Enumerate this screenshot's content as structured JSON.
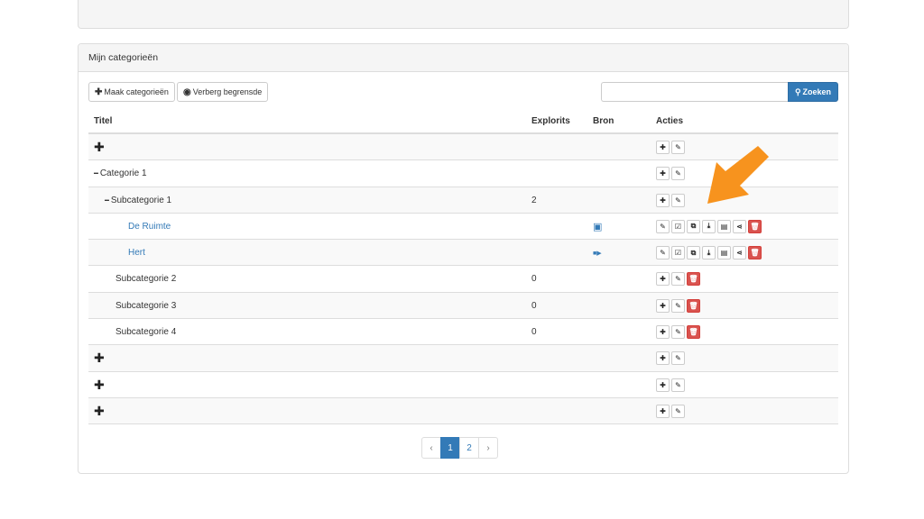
{
  "panel": {
    "heading": "Mijn categorieën"
  },
  "toolbar": {
    "create_label": "Maak categorieën",
    "hide_label": "Verberg begrensde",
    "search_placeholder": "",
    "search_label": "Zoeken"
  },
  "columns": {
    "title": "Titel",
    "explorits": "Explorits",
    "bron": "Bron",
    "acties": "Acties"
  },
  "rows": [
    {
      "title": "",
      "type": "add",
      "explorits": ""
    },
    {
      "title": "Categorie 1",
      "type": "category",
      "explorits": ""
    },
    {
      "title": "Subcategorie 1",
      "type": "subcategory",
      "explorits": "2"
    },
    {
      "title": "De Ruimte",
      "type": "item",
      "explorits": "",
      "bron": "image-icon"
    },
    {
      "title": "Hert",
      "type": "item",
      "explorits": "",
      "bron": "video-icon"
    },
    {
      "title": "Subcategorie 2",
      "type": "subcategory-plain",
      "explorits": "0"
    },
    {
      "title": "Subcategorie 3",
      "type": "subcategory-plain",
      "explorits": "0"
    },
    {
      "title": "Subcategorie 4",
      "type": "subcategory-plain",
      "explorits": "0"
    },
    {
      "title": "",
      "type": "add",
      "explorits": ""
    },
    {
      "title": "",
      "type": "add",
      "explorits": ""
    },
    {
      "title": "",
      "type": "add",
      "explorits": ""
    }
  ],
  "pagination": {
    "prev": "‹",
    "pages": [
      "1",
      "2"
    ],
    "active": "1",
    "next": "›"
  },
  "colors": {
    "accent": "#337ab7",
    "danger": "#d9534f",
    "arrow": "#f7931e"
  }
}
